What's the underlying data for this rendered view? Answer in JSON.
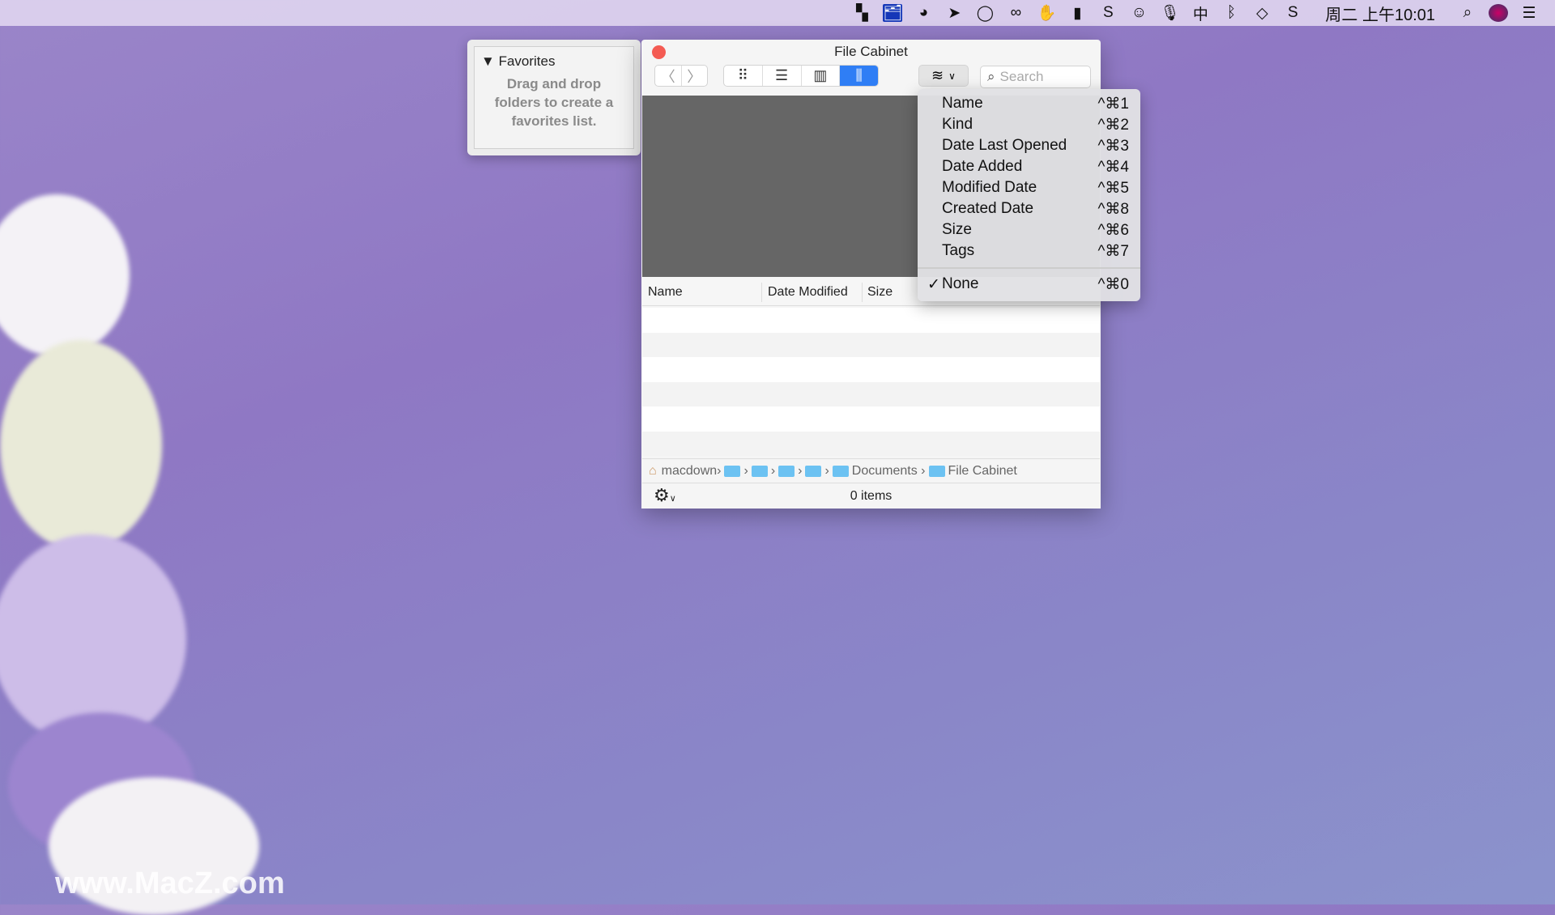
{
  "menubar": {
    "icons": [
      "bookmark-icon",
      "file-cabinet-icon",
      "wechat-icon",
      "telegram-icon",
      "chat-icon",
      "creative-cloud-icon",
      "hand-block-icon",
      "display-icon",
      "s-icon",
      "face-icon",
      "microphone-icon",
      "input-method-icon",
      "bluetooth-icon",
      "wifi-icon",
      "sogou-icon"
    ],
    "input_method": "中",
    "clock": "周二 上午10:01"
  },
  "favorites": {
    "title": "Favorites",
    "hint": "Drag and drop folders to create a favorites list."
  },
  "window": {
    "title": "File Cabinet",
    "search_placeholder": "Search",
    "columns": [
      "Name",
      "Date Modified",
      "Size"
    ],
    "path": [
      "macdown",
      "Documents",
      "File Cabinet"
    ],
    "status": "0 items",
    "accent": "#2f7ef5"
  },
  "sort_menu": {
    "items": [
      {
        "label": "Name",
        "shortcut": "^⌘1"
      },
      {
        "label": "Kind",
        "shortcut": "^⌘2"
      },
      {
        "label": "Date Last Opened",
        "shortcut": "^⌘3"
      },
      {
        "label": "Date Added",
        "shortcut": "^⌘4"
      },
      {
        "label": "Modified Date",
        "shortcut": "^⌘5"
      },
      {
        "label": "Created Date",
        "shortcut": "^⌘8"
      },
      {
        "label": "Size",
        "shortcut": "^⌘6"
      },
      {
        "label": "Tags",
        "shortcut": "^⌘7"
      }
    ],
    "none": {
      "label": "None",
      "shortcut": "^⌘0",
      "checked": true
    }
  },
  "watermark": "www.MacZ.com"
}
